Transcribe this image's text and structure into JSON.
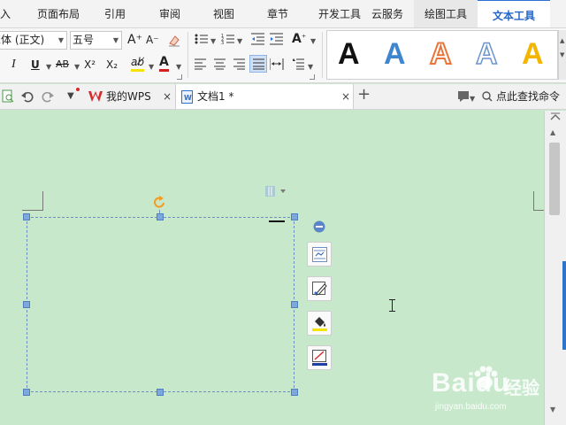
{
  "ribbon_tabs": [
    {
      "label": "插入"
    },
    {
      "label": "页面布局"
    },
    {
      "label": "引用"
    },
    {
      "label": "审阅"
    },
    {
      "label": "视图"
    },
    {
      "label": "章节"
    },
    {
      "label": "开发工具"
    },
    {
      "label": "云服务"
    },
    {
      "label": "绘图工具"
    },
    {
      "label": "文本工具"
    }
  ],
  "active_tab": "文本工具",
  "font": {
    "name_value": "宋体 (正文)",
    "size_value": "五号"
  },
  "format_labels": {
    "italic": "I",
    "underline": "U",
    "strikethrough": "AB",
    "superscript": "X²",
    "subscript": "X₂",
    "highlight": "ab̸",
    "font_color": "A",
    "grow_font": "A⁺",
    "shrink_font": "A⁻"
  },
  "wordart_styles": [
    {
      "glyph": "A",
      "style": "black-filled",
      "color": "#111111"
    },
    {
      "glyph": "A",
      "style": "blue-filled",
      "color": "#3f86cf"
    },
    {
      "glyph": "A",
      "style": "orange-outline",
      "color": "#e8763a"
    },
    {
      "glyph": "A",
      "style": "blue-outline",
      "color": "#6b95cf"
    },
    {
      "glyph": "A",
      "style": "gold-filled",
      "color": "#f2b600"
    }
  ],
  "document_tabs": [
    {
      "label": "我的WPS",
      "close": "×"
    },
    {
      "label": "文档1 *",
      "close": "×"
    }
  ],
  "new_tab_label": "+",
  "search_label": "点此查找命令",
  "watermark": {
    "brand": "Baidu",
    "brand_cn": "经验",
    "url": "jingyan.baidu.com"
  },
  "colors": {
    "accent": "#2465c8",
    "doc_background": "#c8e8cc",
    "wps_red": "#d62b2b",
    "rotate_handle": "#f39c1f"
  }
}
